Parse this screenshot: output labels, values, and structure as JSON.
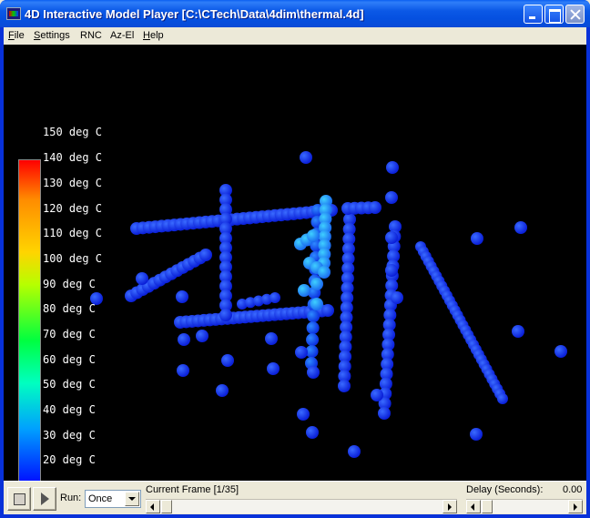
{
  "window": {
    "title": "4D Interactive Model Player  [C:\\CTech\\Data\\4dim\\thermal.4d]"
  },
  "menu": [
    {
      "key": "F",
      "rest": "ile"
    },
    {
      "key": "S",
      "rest": "ettings"
    },
    {
      "key": "",
      "rest": "RNC"
    },
    {
      "key": "",
      "rest": "Az-El"
    },
    {
      "key": "H",
      "rest": "elp"
    }
  ],
  "legend": {
    "labels": [
      "150 deg C",
      "140 deg C",
      "130 deg C",
      "120 deg C",
      "110 deg C",
      "100 deg C",
      "90 deg C",
      "80 deg C",
      "70 deg C",
      "60 deg C",
      "50 deg C",
      "40 deg C",
      "30 deg C",
      "20 deg C"
    ],
    "colors": {
      "top": "#ff0000",
      "bottom": "#0000ff"
    }
  },
  "controls": {
    "run_label": "Run:",
    "run_value": "Once",
    "frame_label": "Current Frame [1/35]",
    "frame_fraction": 0.0,
    "delay_label": "Delay (Seconds):",
    "delay_value": "0.00"
  }
}
